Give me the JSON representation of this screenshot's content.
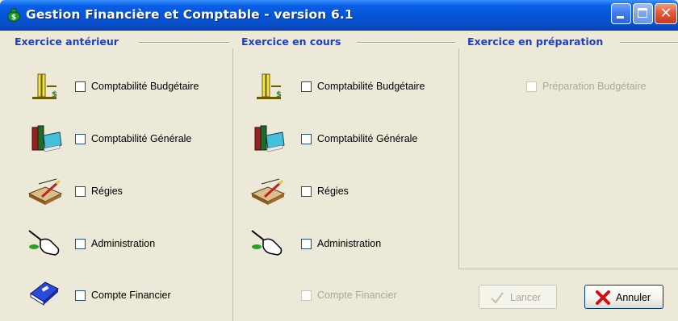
{
  "window": {
    "title": "Gestion Financière et Comptable - version 6.1",
    "icons": {
      "app": "money-bag-icon",
      "minimize": "minimize-icon",
      "maximize": "maximize-icon",
      "close": "close-icon"
    },
    "close_glyph": "✕"
  },
  "sections": {
    "anterieur": {
      "title": "Exercice antérieur",
      "items": [
        {
          "label": "Comptabilité Budgétaire",
          "icon": "balance-scale-icon",
          "checked": false,
          "enabled": true
        },
        {
          "label": "Comptabilité Générale",
          "icon": "books-icon",
          "checked": false,
          "enabled": true
        },
        {
          "label": "Régies",
          "icon": "ledger-pen-icon",
          "checked": false,
          "enabled": true
        },
        {
          "label": "Administration",
          "icon": "hand-pointer-icon",
          "checked": false,
          "enabled": true
        },
        {
          "label": "Compte Financier",
          "icon": "blue-book-icon",
          "checked": false,
          "enabled": true
        }
      ]
    },
    "en_cours": {
      "title": "Exercice en cours",
      "items": [
        {
          "label": "Comptabilité Budgétaire",
          "icon": "balance-scale-icon",
          "checked": false,
          "enabled": true
        },
        {
          "label": "Comptabilité Générale",
          "icon": "books-icon",
          "checked": false,
          "enabled": true
        },
        {
          "label": "Régies",
          "icon": "ledger-pen-icon",
          "checked": false,
          "enabled": true
        },
        {
          "label": "Administration",
          "icon": "hand-pointer-icon",
          "checked": false,
          "enabled": true
        },
        {
          "label": "Compte Financier",
          "icon": "",
          "checked": false,
          "enabled": false
        }
      ]
    },
    "preparation": {
      "title": "Exercice en préparation",
      "items": [
        {
          "label": "Préparation Budgétaire",
          "checked": false,
          "enabled": false
        }
      ]
    }
  },
  "buttons": {
    "lancer": {
      "label": "Lancer",
      "icon": "checkmark-icon",
      "enabled": false
    },
    "annuler": {
      "label": "Annuler",
      "icon": "red-x-icon",
      "enabled": true
    }
  },
  "colors": {
    "title_bar": "#0554d8",
    "section_title": "#1f3ec8",
    "window_bg": "#ece9d8",
    "disabled_text": "#aca899"
  }
}
